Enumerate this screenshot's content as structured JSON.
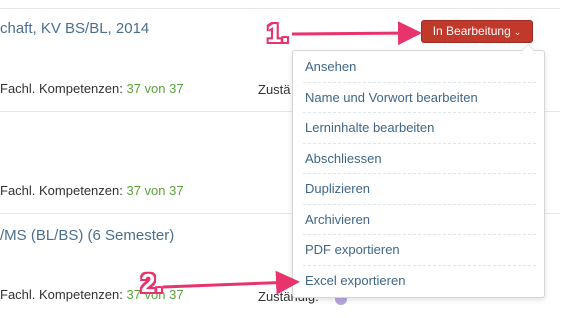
{
  "rows": [
    {
      "title": "chaft, KV BS/BL, 2014",
      "meta_label": "Fachl. Kompetenzen: ",
      "count": "37 von 37",
      "zust": "Zustä"
    },
    {
      "title": "",
      "meta_label": "Fachl. Kompetenzen: ",
      "count": "37 von 37",
      "zust": ""
    },
    {
      "title": "/MS (BL/BS) (6 Semester)",
      "meta_label": "Fachl. Kompetenzen: ",
      "count": "37 von 37",
      "zust": "Zuständig:"
    }
  ],
  "status_button": {
    "label": "In Bearbeitung",
    "chevron": "⌄"
  },
  "menu": {
    "items": [
      "Ansehen",
      "Name und Vorwort bearbeiten",
      "Lerninhalte bearbeiten",
      "Abschliessen",
      "Duplizieren",
      "Archivieren",
      "PDF exportieren",
      "Excel exportieren"
    ]
  },
  "annotations": {
    "step1": "1.",
    "step2": "2."
  },
  "colors": {
    "accent": "#e8336c",
    "status": "#c0392b",
    "link": "#3f6789",
    "count": "#5aa33a"
  }
}
